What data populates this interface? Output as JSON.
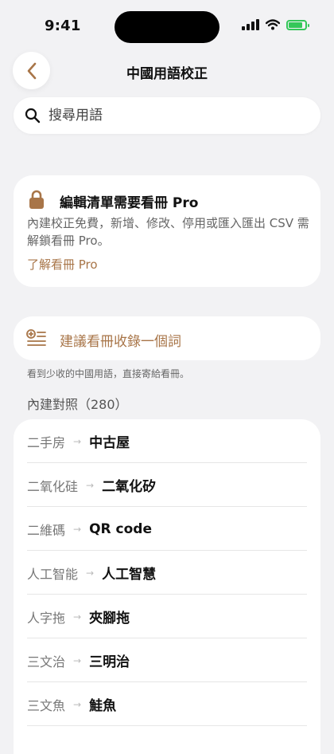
{
  "status_bar": {
    "time": "9:41"
  },
  "nav": {
    "title": "中國用語校正"
  },
  "search": {
    "placeholder": "搜尋用語",
    "value": ""
  },
  "pro_card": {
    "title": "編輯清單需要看冊 Pro",
    "description": "內建校正免費，新增、修改、停用或匯入匯出 CSV 需解鎖看冊 Pro。",
    "link": "了解看冊 Pro"
  },
  "suggest": {
    "label": "建議看冊收錄一個詞",
    "caption": "看到少收的中國用語，直接寄給看冊。"
  },
  "builtin": {
    "header": "內建對照（280）",
    "items": [
      {
        "from": "二手房",
        "to": "中古屋"
      },
      {
        "from": "二氧化硅",
        "to": "二氧化矽"
      },
      {
        "from": "二維碼",
        "to": "QR code"
      },
      {
        "from": "人工智能",
        "to": "人工智慧"
      },
      {
        "from": "人字拖",
        "to": "夾腳拖"
      },
      {
        "from": "三文治",
        "to": "三明治"
      },
      {
        "from": "三文魚",
        "to": "鮭魚"
      }
    ]
  },
  "colors": {
    "accent": "#a87548",
    "battery": "#34c759",
    "background": "#f2f2f4"
  },
  "icons": [
    "chevron-left-icon",
    "search-icon",
    "lock-icon",
    "add-list-icon",
    "arrow-right-icon"
  ]
}
